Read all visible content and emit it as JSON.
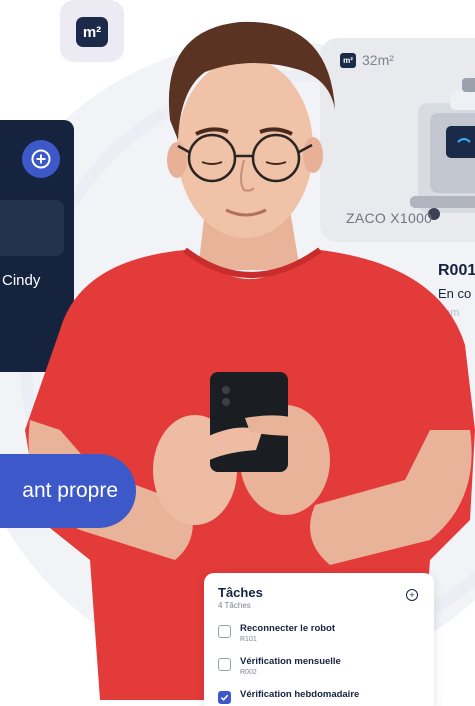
{
  "badges": {
    "area_unit": "m²",
    "robot_area": "32m²"
  },
  "robot_card": {
    "name": "ZACO X1000",
    "code": "R001",
    "status": "En co",
    "room": "oom"
  },
  "side_card": {
    "user_name": "Cindy"
  },
  "banner": {
    "text": "ant propre"
  },
  "tasks": {
    "title": "Tâches",
    "count": "4 Tâches",
    "items": [
      {
        "label": "Reconnecter le robot",
        "code": "R101",
        "checked": false
      },
      {
        "label": "Vérification mensuelle",
        "code": "R002",
        "checked": false
      },
      {
        "label": "Vérification hebdomadaire",
        "code": "",
        "checked": true
      }
    ]
  },
  "colors": {
    "navy": "#15233f",
    "accent_blue": "#3d58c9",
    "shirt_red": "#e33a3a",
    "backdrop": "#f2f3f7"
  }
}
